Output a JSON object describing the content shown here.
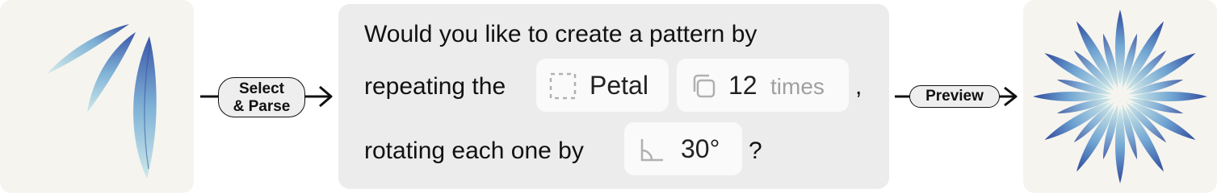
{
  "input_image": {
    "name": "petal",
    "color_light": "#b9e0e4",
    "color_dark": "#3a56a8"
  },
  "connector_left": {
    "label_line1": "Select",
    "label_line2": "& Parse"
  },
  "question": {
    "line1": "Would you like to create a pattern by",
    "line2_prefix": "repeating the",
    "line2_suffix": ",",
    "line3_prefix": "rotating each one by",
    "line3_suffix": "?",
    "shape_chip": {
      "icon": "dashed-selection-icon",
      "value": "Petal"
    },
    "repeat_chip": {
      "icon": "copy-icon",
      "value": "12",
      "unit": "times"
    },
    "angle_chip": {
      "icon": "angle-icon",
      "value": "30°"
    }
  },
  "connector_right": {
    "label": "Preview"
  },
  "output_image": {
    "name": "petal-radial-pattern",
    "petal_count": 12,
    "rotation_deg": 30
  },
  "colors": {
    "panel_bg": "#f6f4ef",
    "card_bg": "#ececec",
    "chip_bg": "#fafafa",
    "pill_bg": "#eeeeee"
  }
}
